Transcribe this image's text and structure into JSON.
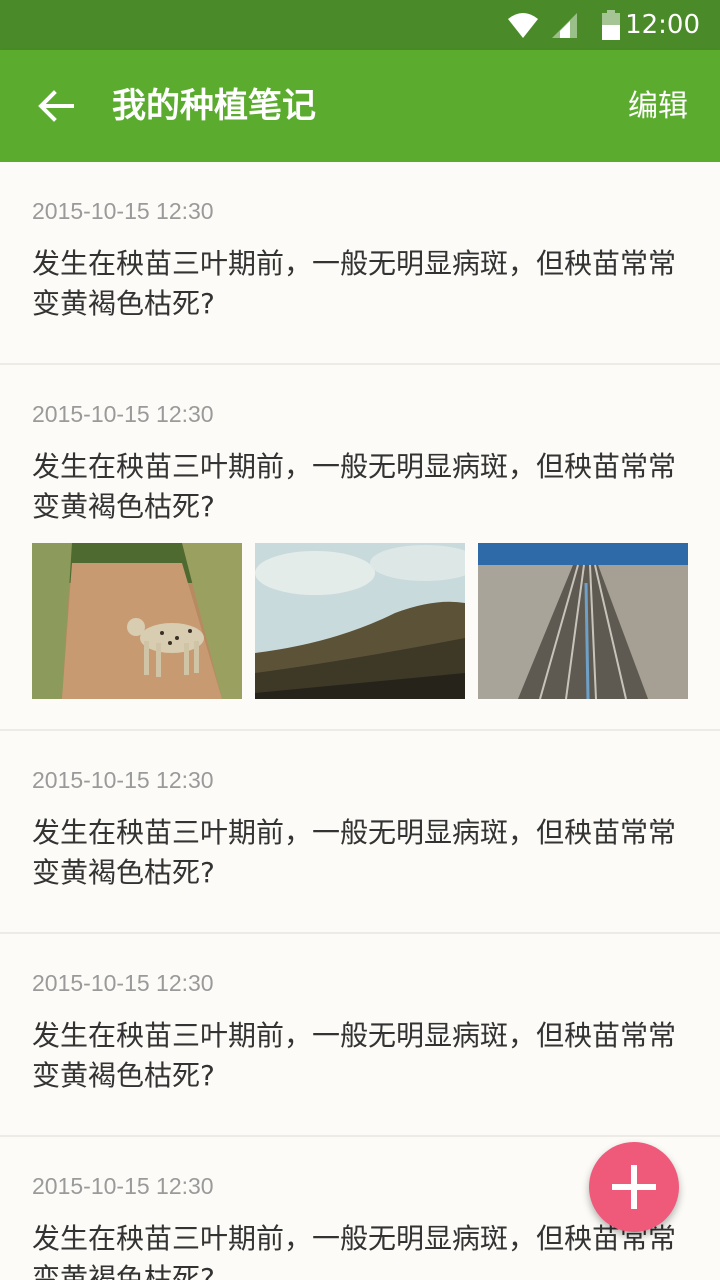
{
  "status_bar": {
    "time": "12:00"
  },
  "app_bar": {
    "title": "我的种植笔记",
    "edit_label": "编辑"
  },
  "notes": [
    {
      "date": "2015-10-15 12:30",
      "text": "发生在秧苗三叶期前，一般无明显病斑，但秧苗常常变黄褐色枯死?"
    },
    {
      "date": "2015-10-15 12:30",
      "text": "发生在秧苗三叶期前，一般无明显病斑，但秧苗常常变黄褐色枯死?",
      "photos": [
        "leopard-on-dirt-road",
        "grassy-hillside",
        "railway-tracks"
      ]
    },
    {
      "date": "2015-10-15 12:30",
      "text": "发生在秧苗三叶期前，一般无明显病斑，但秧苗常常变黄褐色枯死?"
    },
    {
      "date": "2015-10-15 12:30",
      "text": "发生在秧苗三叶期前，一般无明显病斑，但秧苗常常变黄褐色枯死?"
    },
    {
      "date": "2015-10-15 12:30",
      "text": "发生在秧苗三叶期前，一般无明显病斑，但秧苗常常变黄褐色枯死?"
    }
  ],
  "colors": {
    "primary": "#5aab2e",
    "primary_dark": "#4a8a28",
    "fab": "#f05a7a"
  }
}
